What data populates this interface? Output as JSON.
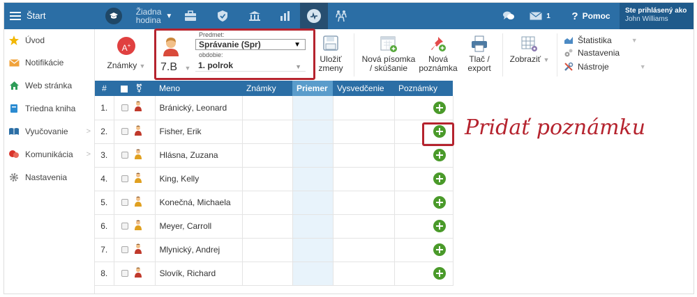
{
  "topbar": {
    "start_label": "Štart",
    "hodina_line1": "Žiadna",
    "hodina_line2": "hodina",
    "messages_count": "1",
    "help_label": "Pomoc",
    "logged_in_label": "Ste prihlásený ako",
    "user_name": "John Williams"
  },
  "sidebar": {
    "items": [
      {
        "label": "Úvod",
        "icon": "star-icon"
      },
      {
        "label": "Notifikácie",
        "icon": "envelope-icon"
      },
      {
        "label": "Web stránka",
        "icon": "home-icon"
      },
      {
        "label": "Triedna kniha",
        "icon": "book-icon"
      },
      {
        "label": "Vyučovanie",
        "icon": "open-book-icon"
      },
      {
        "label": "Komunikácia",
        "icon": "chat-icon"
      },
      {
        "label": "Nastavenia",
        "icon": "gear-icon"
      }
    ]
  },
  "toolbar": {
    "znamky_label": "Známky",
    "class_value": "7.B",
    "predmet_label": "Predmet:",
    "predmet_value": "Správanie (Spr)",
    "obdobie_label": "obdobie:",
    "obdobie_value": "1. polrok",
    "save_line1": "Uložiť",
    "save_line2": "zmeny",
    "new_test_line1": "Nová písomka",
    "new_test_line2": "/ skúšanie",
    "new_note_line1": "Nová",
    "new_note_line2": "poznámka",
    "print_line1": "Tlač /",
    "print_line2": "export",
    "view_label": "Zobraziť",
    "stats_label": "Štatistika",
    "settings_label": "Nastavenia",
    "tools_label": "Nástroje"
  },
  "table": {
    "headers": {
      "num": "#",
      "name": "Meno",
      "grades": "Známky",
      "avg": "Priemer",
      "report": "Vysvedčenie",
      "notes": "Poznámky"
    },
    "rows": [
      {
        "num": "1.",
        "name": "Bránický, Leonard",
        "gender": "male"
      },
      {
        "num": "2.",
        "name": "Fisher, Erik",
        "gender": "male"
      },
      {
        "num": "3.",
        "name": "Hlásna, Zuzana",
        "gender": "female"
      },
      {
        "num": "4.",
        "name": "King, Kelly",
        "gender": "female"
      },
      {
        "num": "5.",
        "name": "Konečná, Michaela",
        "gender": "female"
      },
      {
        "num": "6.",
        "name": "Meyer, Carroll",
        "gender": "female"
      },
      {
        "num": "7.",
        "name": "Mlynický, Andrej",
        "gender": "male"
      },
      {
        "num": "8.",
        "name": "Slovík, Richard",
        "gender": "male"
      }
    ]
  },
  "callout": {
    "text": "Pridať poznámku"
  },
  "colors": {
    "topbar": "#2b6ea5",
    "accent_red": "#b5232e",
    "add_green": "#4a9a2a",
    "avg_column": "#e8f3fb"
  }
}
